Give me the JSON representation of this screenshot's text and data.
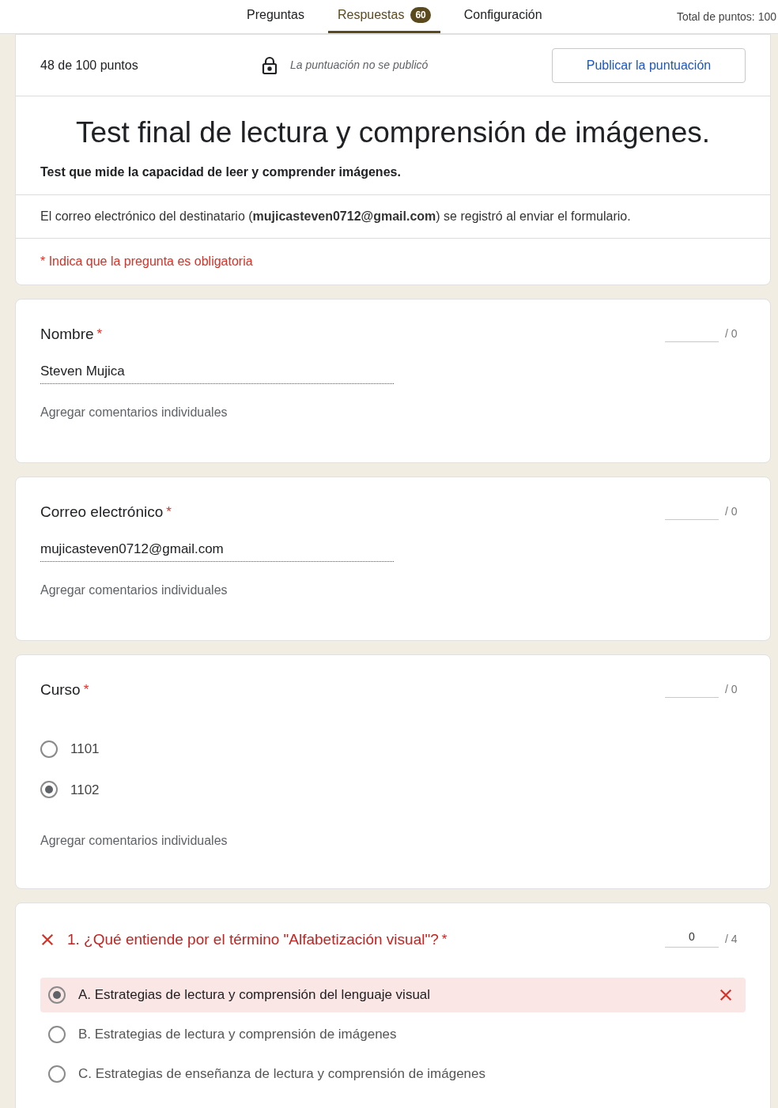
{
  "tabs": [
    {
      "label": "Preguntas",
      "selected": false
    },
    {
      "label": "Respuestas",
      "selected": true,
      "badge": "60"
    },
    {
      "label": "Configuración",
      "selected": false
    }
  ],
  "total_points": "Total de puntos: 100",
  "score": {
    "text": "48 de 100 puntos",
    "status": "La puntuación no se publicó",
    "publish_button": "Publicar la puntuación"
  },
  "form": {
    "title": "Test final de lectura y comprensión de imágenes.",
    "description": "Test que mide la capacidad de leer y comprender imágenes.",
    "email_notice": "El correo electrónico del destinatario (**mujicasteven0712@gmail.com**) se registró al enviar el formulario.",
    "required_note": "* Indica que la pregunta es obligatoria"
  },
  "questions": [
    {
      "kind": "text",
      "title": "Nombre",
      "required_mark": "*",
      "points_max": "/ 0",
      "answer": "Steven Mujica",
      "comment_link": "Agregar comentarios individuales"
    },
    {
      "kind": "text",
      "title": "Correo electrónico",
      "required_mark": "*",
      "points_max": "/ 0",
      "answer": "mujicasteven0712@gmail.com",
      "comment_link": "Agregar comentarios individuales"
    },
    {
      "kind": "choice",
      "title": "Curso",
      "required_mark": "*",
      "points_max": "/ 0",
      "options": [
        {
          "label": "1101",
          "selected": false
        },
        {
          "label": "1102",
          "selected": true
        }
      ],
      "comment_link": "Agregar comentarios individuales"
    },
    {
      "kind": "graded",
      "correct": false,
      "title": "1. ¿Qué entiende por el término \"Alfabetización visual\"?",
      "required_mark": "*",
      "points_value": "0",
      "points_max": "/ 4",
      "options": [
        {
          "label": "A. Estrategias de lectura y comprensión del lenguaje visual",
          "selected": true,
          "incorrect": true
        },
        {
          "label": "B. Estrategias de lectura y comprensión de imágenes",
          "selected": false,
          "incorrect": false
        },
        {
          "label": "C. Estrategias de enseñanza de lectura y comprensión de imágenes",
          "selected": false,
          "incorrect": false
        }
      ]
    }
  ]
}
